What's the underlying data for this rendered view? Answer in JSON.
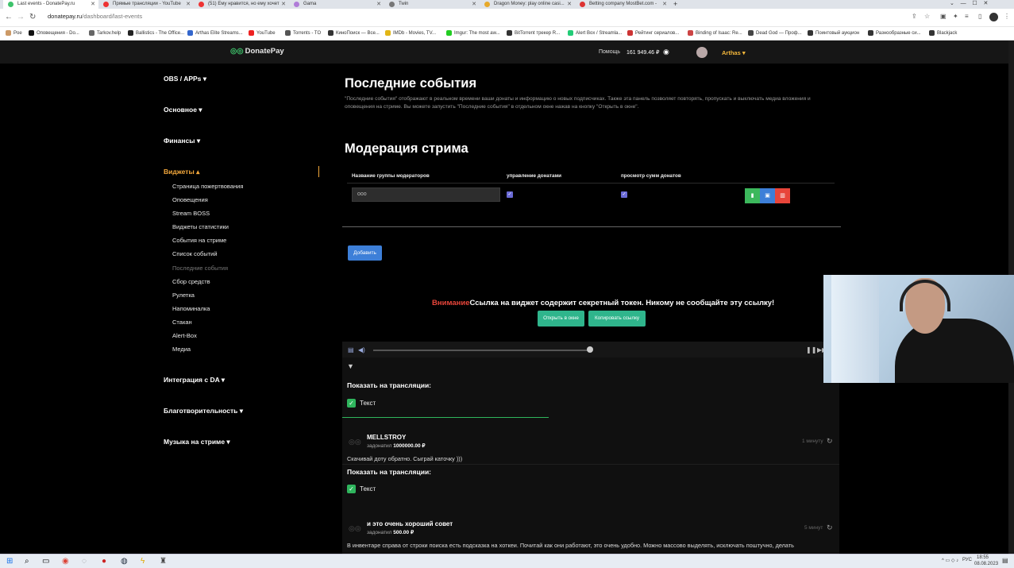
{
  "tabs": [
    {
      "title": "Last events - DonatePay.ru",
      "color": "#3ec36b",
      "active": true
    },
    {
      "title": "Прямые трансляции - YouTube",
      "color": "#e33"
    },
    {
      "title": "(51) Ему нравится, но ему хочет",
      "color": "#e33"
    },
    {
      "title": "Gama",
      "color": "#b07cd8"
    },
    {
      "title": "Twin",
      "color": "#777"
    },
    {
      "title": "Dragon Money: play online casi...",
      "color": "#e7a92a"
    },
    {
      "title": "Betting company MostBet.com -",
      "color": "#d33"
    }
  ],
  "address": {
    "host": "donatepay.ru",
    "path": "/dashboard/last-events"
  },
  "bookmarks": [
    {
      "label": "Poe",
      "color": "#c96"
    },
    {
      "label": "Оповещения - Do...",
      "color": "#111"
    },
    {
      "label": "Tarkov.help",
      "color": "#666"
    },
    {
      "label": "Ballistics - The Office...",
      "color": "#222"
    },
    {
      "label": "Arthas Elite Streams...",
      "color": "#36c"
    },
    {
      "label": "YouTube",
      "color": "#e22"
    },
    {
      "label": "Torrents - TO",
      "color": "#555"
    },
    {
      "label": "КиноПоиск — Все...",
      "color": "#333"
    },
    {
      "label": "IMDb - Movies, TV...",
      "color": "#e2b616"
    },
    {
      "label": "Imgur: The most aw...",
      "color": "#2c2"
    },
    {
      "label": "BitTorrent трекер R...",
      "color": "#333"
    },
    {
      "label": "Alert Box / Streamla...",
      "color": "#2c7"
    },
    {
      "label": "Рейтинг сериалов...",
      "color": "#c33"
    },
    {
      "label": "Binding of Isaac: Re...",
      "color": "#c44"
    },
    {
      "label": "Dead God — Проф...",
      "color": "#444"
    },
    {
      "label": "Поинтовый аукцион",
      "color": "#333"
    },
    {
      "label": "Разнообразные си...",
      "color": "#333"
    },
    {
      "label": "Blackjack",
      "color": "#333"
    }
  ],
  "header": {
    "logo": "DonatePay",
    "help": "Помощь",
    "balance": "161 949.46 ₽",
    "user": "Arthas ▾"
  },
  "sidebar": {
    "sections": [
      {
        "label": "OBS / APPs ▾"
      },
      {
        "label": "Основное ▾"
      },
      {
        "label": "Финансы ▾"
      },
      {
        "label": "Виджеты ▴"
      },
      {
        "label": "Интеграция с DA ▾"
      },
      {
        "label": "Благотворительность ▾"
      },
      {
        "label": "Музыка на стриме ▾"
      }
    ],
    "widgets": [
      "Страница пожертвования",
      "Оповещения",
      "Stream BOSS",
      "Виджеты статистики",
      "События на стриме",
      "Список событий",
      "Последние события",
      "Сбор средств",
      "Рулетка",
      "Напоминалка",
      "Стакан",
      "Alert-Box",
      "Медиа"
    ]
  },
  "main": {
    "title": "Последние события",
    "description": "\"Последние события\" отображают в реальном времени ваши донаты и информацию о новых подписчиках. Также эта панель позволяет повторять, пропускать и выключать медиа вложения и оповещения на стриме. Вы можете запустить \"Последние события\" в отдельном окне нажав на кнопку \"Открыть в окне\".",
    "moderation_title": "Модерация стрима",
    "columns": [
      "Название группы модераторов",
      "управление донатами",
      "просмотр сумм донатов"
    ],
    "group_name": "ooo",
    "add_label": "Добавить",
    "warning_red": "Внимание",
    "warning_text": "Ссылка на виджет содержит секретный токен. Никому не сообщайте эту ссылку!",
    "open_window": "Открыть в окне",
    "copy_link": "Копировать ссылку"
  },
  "player": {
    "volume_level": 1.0
  },
  "feed": {
    "show_label": "Показать на трансляции:",
    "text_label": "Текст",
    "events": [
      {
        "name": "MELLSTROY",
        "prefix": "задонатил",
        "amount": "1000000.00 ₽",
        "time": "1 минуту",
        "message": "Скачивай доту обратно. Сыграй каточку )))"
      },
      {
        "name": "и это очень хороший совет",
        "prefix": "задонатил",
        "amount": "500.00 ₽",
        "time": "5 минут",
        "message": "В инвентаре справа от строки поиска есть подсказка на хоткеи. Почитай как они работают, это очень удобно. Можно массово выделять, исключать поштучно, делать"
      }
    ]
  },
  "taskbar": {
    "lang": "РУС",
    "time": "18:55",
    "date": "08.08.2023"
  }
}
